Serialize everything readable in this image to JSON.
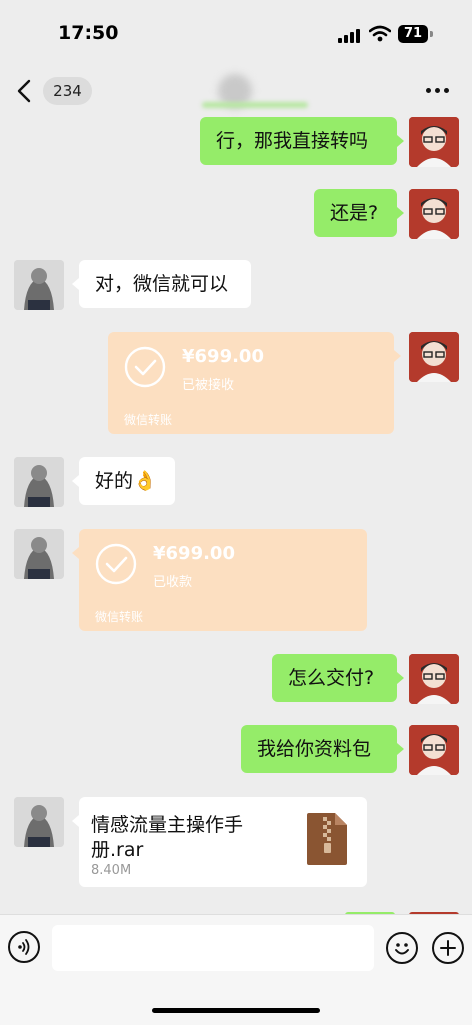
{
  "status_bar": {
    "time": "17:50",
    "battery": "71",
    "icons": [
      "signal-icon",
      "wifi-icon",
      "battery-icon"
    ]
  },
  "nav": {
    "unread_count": "234",
    "back_icon": "chevron-left-icon",
    "more_icon": "more-horizontal-icon"
  },
  "colors": {
    "background": "#ededed",
    "self_bubble": "#95ec69",
    "other_bubble": "#ffffff",
    "transfer_card": "#fcdfc1",
    "self_avatar": "#b43a2c"
  },
  "messages": [
    {
      "sender": "self",
      "type": "text",
      "text": "行，那我直接转吗"
    },
    {
      "sender": "self",
      "type": "text",
      "text": "还是?"
    },
    {
      "sender": "other",
      "type": "text",
      "text": "对，微信就可以"
    },
    {
      "sender": "self",
      "type": "transfer",
      "amount": "¥699.00",
      "status": "已被接收",
      "label": "微信转账"
    },
    {
      "sender": "other",
      "type": "text",
      "text": "好的👌"
    },
    {
      "sender": "other",
      "type": "transfer",
      "amount": "¥699.00",
      "status": "已收款",
      "label": "微信转账"
    },
    {
      "sender": "self",
      "type": "text",
      "text": "怎么交付?"
    },
    {
      "sender": "self",
      "type": "text",
      "text": "我给你资料包"
    },
    {
      "sender": "other",
      "type": "file",
      "file_name": "情感流量主操作手册.rar",
      "file_size": "8.40M"
    }
  ],
  "input_bar": {
    "voice_icon": "voice-icon",
    "emoji_icon": "emoji-icon",
    "plus_icon": "plus-circle-icon"
  }
}
